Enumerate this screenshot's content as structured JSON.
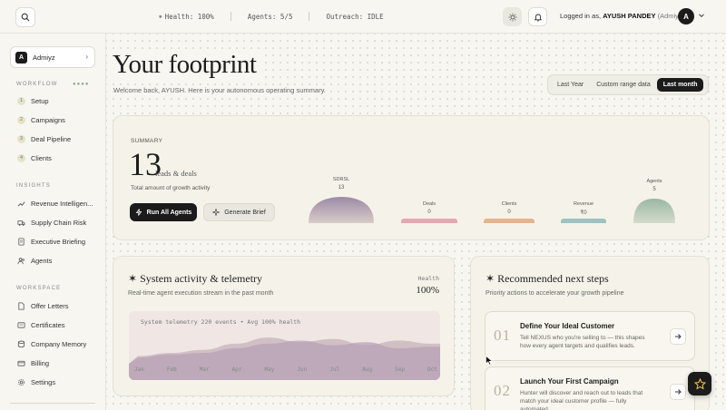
{
  "topbar": {
    "status": {
      "health": "Health: 100%",
      "agents": "Agents: 5/5",
      "outreach": "Outreach: IDLE"
    },
    "user": {
      "prefix": "Logged in as,",
      "name": "AYUSH PANDEY",
      "role": "(Admiyz)",
      "initial": "A"
    },
    "icons": [
      "search-icon",
      "sun-icon",
      "bell-icon",
      "chevron-down-icon"
    ]
  },
  "sidebar": {
    "org": {
      "initial": "A",
      "name": "Admiyz"
    },
    "workflow_label": "WORKFLOW",
    "workflow_dots": "●●●●",
    "workflow": [
      {
        "num": "1",
        "label": "Setup"
      },
      {
        "num": "2",
        "label": "Campaigns"
      },
      {
        "num": "3",
        "label": "Deal Pipeline"
      },
      {
        "num": "4",
        "label": "Clients"
      }
    ],
    "insights_label": "INSIGHTS",
    "insights": [
      {
        "icon": "trend-icon",
        "label": "Revenue Intelligen..."
      },
      {
        "icon": "truck-icon",
        "label": "Supply Chain Risk"
      },
      {
        "icon": "document-icon",
        "label": "Executive Briefing"
      },
      {
        "icon": "users-icon",
        "label": "Agents"
      }
    ],
    "workspace_label": "WORKSPACE",
    "workspace": [
      {
        "icon": "file-icon",
        "label": "Offer Letters"
      },
      {
        "icon": "certificate-icon",
        "label": "Certificates"
      },
      {
        "icon": "database-icon",
        "label": "Company Memory"
      },
      {
        "icon": "card-icon",
        "label": "Billing"
      },
      {
        "icon": "gear-icon",
        "label": "Settings"
      }
    ]
  },
  "main": {
    "title": "Your footprint",
    "welcome": "Welcome back, AYUSH. Here is your autonomous operating summary.",
    "ranges": [
      "Last Year",
      "Custom range data",
      "Last month"
    ],
    "active_range": "Last month",
    "summary": {
      "label": "SUMMARY",
      "value": "13",
      "unit": "leads & deals",
      "desc": "Total amount of growth activity",
      "run_label": "Run All Agents",
      "brief_label": "Generate Brief",
      "metrics": [
        {
          "label": "SDRSL",
          "value": "13",
          "color": "#9b8aa6"
        },
        {
          "label": "Deals",
          "value": "0",
          "color": "#e3a9b2"
        },
        {
          "label": "Clients",
          "value": "0",
          "color": "#e6b48e"
        },
        {
          "label": "Revenue",
          "value": "₹0",
          "color": "#9ec2c0"
        },
        {
          "label": "Agents",
          "value": "5",
          "color": "#9bb7a4"
        }
      ]
    },
    "telemetry": {
      "title": "System activity & telemetry",
      "subtitle": "Real-time agent execution stream in the past month",
      "health_label": "Health",
      "health_value": "100%",
      "chart_note": "System telemetry 220 events • Avg 100% health",
      "months": [
        "Jan",
        "Feb",
        "Mar",
        "Apr",
        "May",
        "Jun",
        "Jul",
        "Aug",
        "Sep",
        "Oct"
      ]
    },
    "reco": {
      "title": "Recommended next steps",
      "subtitle": "Priority actions to accelerate your growth pipeline",
      "steps": [
        {
          "num": "01",
          "title": "Define Your Ideal Customer",
          "desc": "Tell NEXUS who you're selling to — this shapes how every agent targets and qualifies leads."
        },
        {
          "num": "02",
          "title": "Launch Your First Campaign",
          "desc": "Hunter will discover and reach out to leads that match your ideal customer profile — fully automated."
        }
      ]
    }
  },
  "chart_data": {
    "type": "area",
    "title": "",
    "categories": [
      "Jan",
      "Feb",
      "Mar",
      "Apr",
      "May",
      "Jun",
      "Jul",
      "Aug",
      "Sep",
      "Oct"
    ],
    "series": [
      {
        "values": [
          10,
          14,
          18,
          26,
          34,
          28,
          32,
          24,
          30,
          26
        ]
      },
      {
        "values": [
          8,
          12,
          14,
          20,
          26,
          30,
          24,
          28,
          20,
          22
        ]
      }
    ],
    "grid": false
  }
}
